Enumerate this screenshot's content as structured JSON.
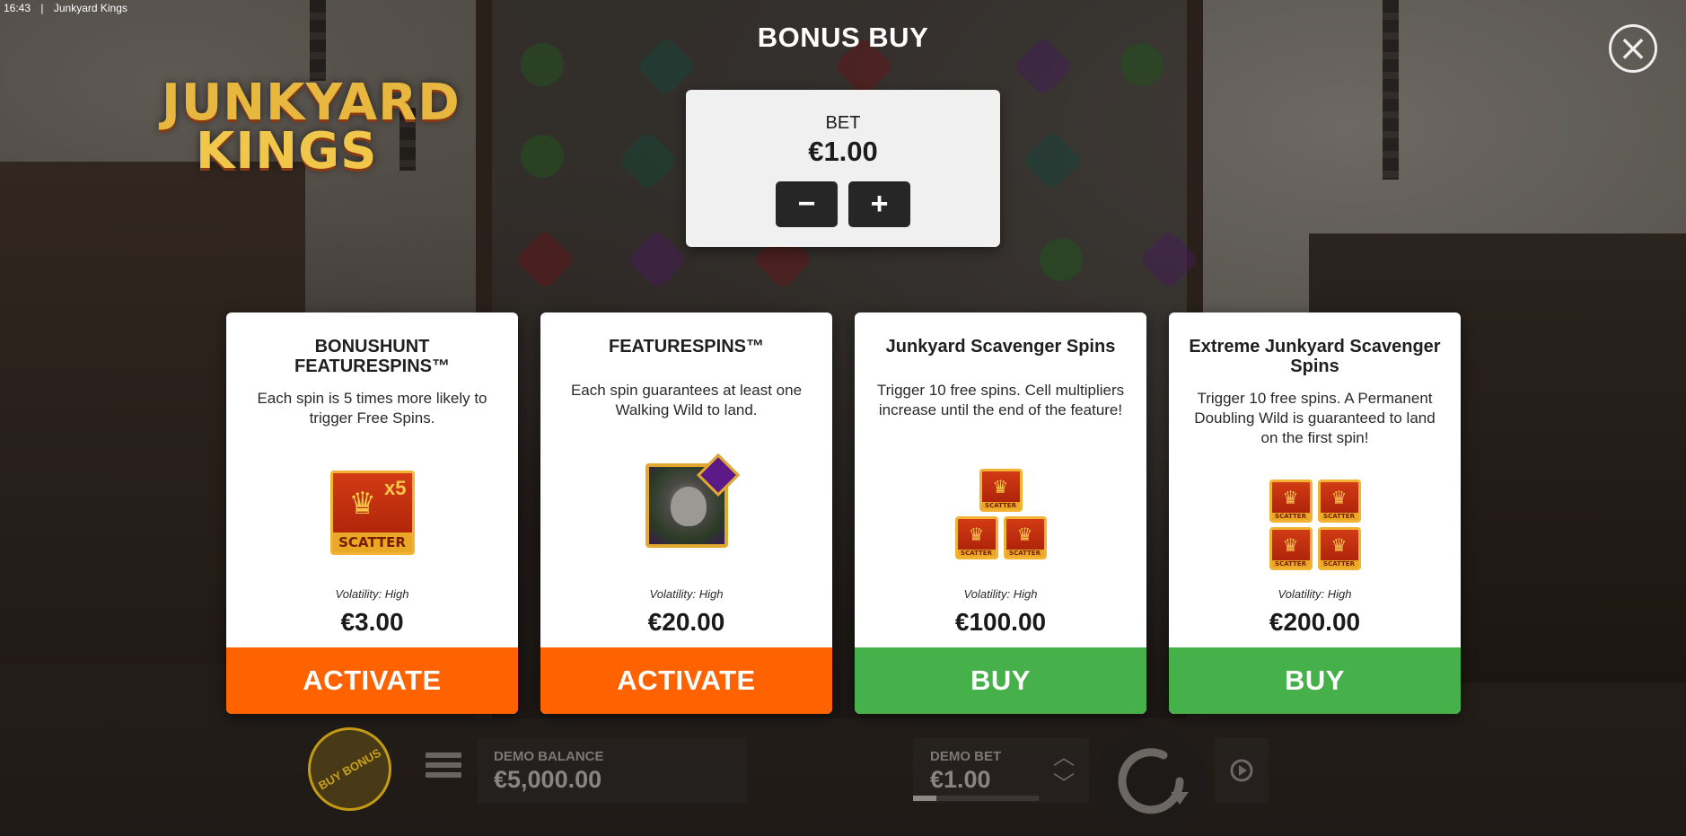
{
  "status_bar": {
    "time": "16:43",
    "separator": "|",
    "app_title": "Junkyard Kings"
  },
  "logo": {
    "line1": "JUNKYARD",
    "line2": "KINGS"
  },
  "dialog": {
    "title": "BONUS BUY",
    "close_icon": "close-icon",
    "bet": {
      "label": "BET",
      "value": "€1.00",
      "decrease_label": "−",
      "increase_label": "+"
    }
  },
  "cards": [
    {
      "title": "BONUSHUNT FEATURESPINS™",
      "description": "Each spin is 5 times more likely to trigger Free Spins.",
      "art": "scatter-x5-icon",
      "art_text": {
        "multiplier": "x5",
        "word": "SCATTER"
      },
      "volatility": "Volatility: High",
      "price": "€3.00",
      "action_label": "ACTIVATE",
      "action_color": "#ff6200"
    },
    {
      "title": "FEATURESPINS™",
      "description": "Each spin guarantees at least one Walking Wild to land.",
      "art": "walking-wild-icon",
      "volatility": "Volatility: High",
      "price": "€20.00",
      "action_label": "ACTIVATE",
      "action_color": "#ff6200"
    },
    {
      "title": "Junkyard Scavenger Spins",
      "description": "Trigger 10 free spins. Cell multipliers increase until the end of the feature!",
      "art": "three-scatters-icon",
      "art_text": {
        "word": "SCATTER"
      },
      "volatility": "Volatility: High",
      "price": "€100.00",
      "action_label": "BUY",
      "action_color": "#46b04a"
    },
    {
      "title": "Extreme Junkyard Scavenger Spins",
      "description": "Trigger 10 free spins. A Permanent Doubling Wild is guaranteed to land on the first spin!",
      "art": "four-scatters-icon",
      "art_text": {
        "word": "SCATTER"
      },
      "volatility": "Volatility: High",
      "price": "€200.00",
      "action_label": "BUY",
      "action_color": "#46b04a"
    }
  ],
  "bottom_bar": {
    "buy_bonus_label": "BUY BONUS",
    "menu_icon": "menu-icon",
    "balance_label": "DEMO BALANCE",
    "balance_value": "€5,000.00",
    "bet_label": "DEMO BET",
    "bet_value": "€1.00",
    "bet_up_icon": "chevron-up-icon",
    "bet_down_icon": "chevron-down-icon",
    "spin_icon": "spin-icon",
    "autoplay_icon": "autoplay-icon"
  }
}
